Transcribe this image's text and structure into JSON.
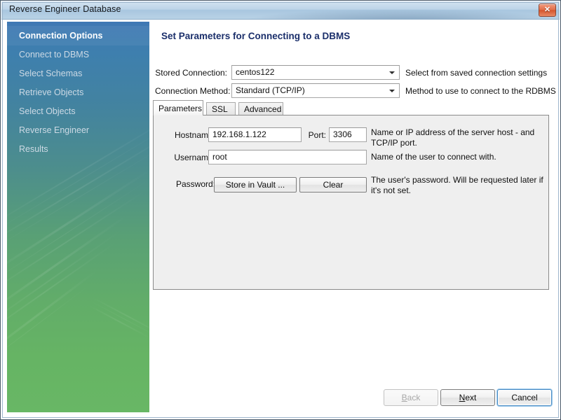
{
  "window": {
    "title": "Reverse Engineer Database",
    "close_icon": "close-icon",
    "close_glyph": "✕"
  },
  "sidebar": {
    "items": [
      {
        "label": "Connection Options",
        "active": true
      },
      {
        "label": "Connect to DBMS",
        "active": false
      },
      {
        "label": "Select Schemas",
        "active": false
      },
      {
        "label": "Retrieve Objects",
        "active": false
      },
      {
        "label": "Select Objects",
        "active": false
      },
      {
        "label": "Reverse Engineer",
        "active": false
      },
      {
        "label": "Results",
        "active": false
      }
    ],
    "gradient_top": "#3f78b4",
    "gradient_bottom": "#68b765"
  },
  "main": {
    "page_title": "Set Parameters for Connecting to a DBMS",
    "stored_connection": {
      "label": "Stored Connection:",
      "value": "centos122",
      "hint": "Select from saved connection settings"
    },
    "connection_method": {
      "label": "Connection Method:",
      "value": "Standard (TCP/IP)",
      "hint": "Method to use to connect to the RDBMS"
    },
    "tabs": [
      {
        "label": "Parameters",
        "active": true
      },
      {
        "label": "SSL",
        "active": false
      },
      {
        "label": "Advanced",
        "active": false
      }
    ],
    "parameters": {
      "hostname": {
        "label": "Hostname:",
        "value": "192.168.1.122"
      },
      "port": {
        "label": "Port:",
        "value": "3306"
      },
      "hostname_desc": "Name or IP address of the server host - and TCP/IP port.",
      "username": {
        "label": "Username:",
        "value": "root"
      },
      "username_desc": "Name of the user to connect with.",
      "password": {
        "label": "Password:",
        "store_button": "Store in Vault ...",
        "clear_button": "Clear"
      },
      "password_desc": "The user's password. Will be requested later if it's not set."
    }
  },
  "footer": {
    "back": {
      "label": "Back",
      "mnemonic": "B",
      "rest": "ack",
      "disabled": true
    },
    "next": {
      "label": "Next",
      "mnemonic": "N",
      "rest": "ext",
      "disabled": false
    },
    "cancel": {
      "label": "Cancel",
      "disabled": false,
      "default": true
    }
  }
}
